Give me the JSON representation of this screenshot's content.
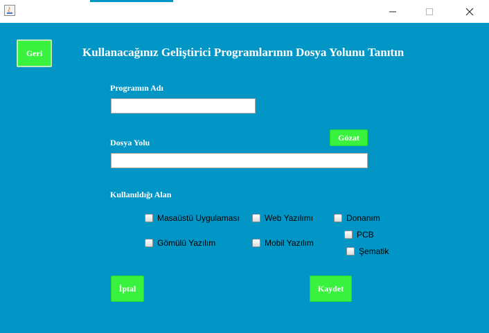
{
  "window": {
    "controls": {
      "minimize": "minimize-icon",
      "maximize": "maximize-icon",
      "close": "close-icon"
    }
  },
  "form": {
    "back_label": "Geri",
    "heading": "Kullanacağınız Geliştirici Programlarının Dosya Yolunu Tanıtın",
    "program_name_label": "Programın Adı",
    "program_name_value": "",
    "file_path_label": "Dosya Yolu",
    "file_path_value": "",
    "browse_label": "Gözat",
    "usage_area_label": "Kullanıldığı Alan",
    "areas": [
      {
        "label": "Masaüstü Uygulaması",
        "checked": false
      },
      {
        "label": "Web Yazılımı",
        "checked": false
      },
      {
        "label": "Donanım",
        "checked": false
      },
      {
        "label": "PCB",
        "checked": false
      },
      {
        "label": "Gömülü Yazılım",
        "checked": false
      },
      {
        "label": "Mobil Yazılım",
        "checked": false
      },
      {
        "label": "Şematik",
        "checked": false
      }
    ],
    "cancel_label": "İptal",
    "save_label": "Kaydet"
  },
  "colors": {
    "background": "#0296c6",
    "button": "#39f23e",
    "text": "#ffffff"
  }
}
